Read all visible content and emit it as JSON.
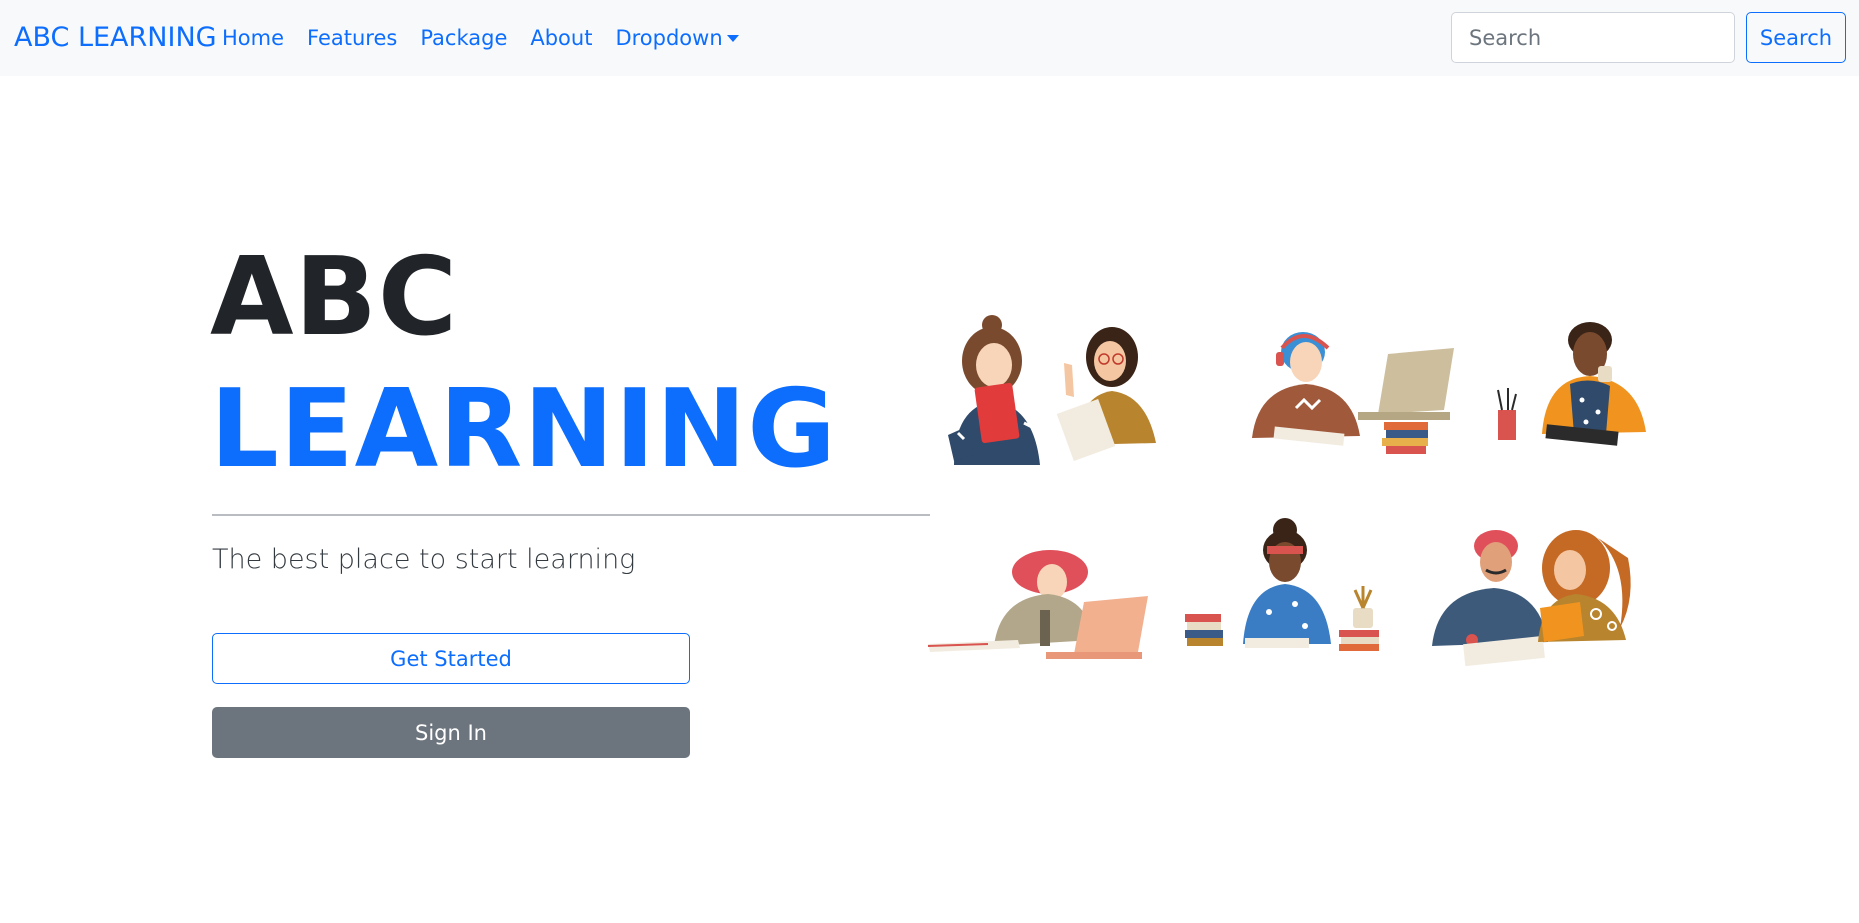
{
  "navbar": {
    "brand": "ABC LEARNING",
    "links": [
      "Home",
      "Features",
      "Package",
      "About"
    ],
    "dropdown_label": "Dropdown",
    "search_placeholder": "Search",
    "search_button": "Search"
  },
  "hero": {
    "title_line1": "ABC",
    "title_line2": "LEARNING",
    "subtitle": "The best place to start learning",
    "get_started_label": "Get Started",
    "sign_in_label": "Sign In"
  },
  "colors": {
    "primary": "#0d6efd",
    "secondary": "#6c757d",
    "dark": "#212529",
    "navbar_bg": "#f8f9fa"
  },
  "illustration": {
    "icon": "students-studying-illustration"
  }
}
